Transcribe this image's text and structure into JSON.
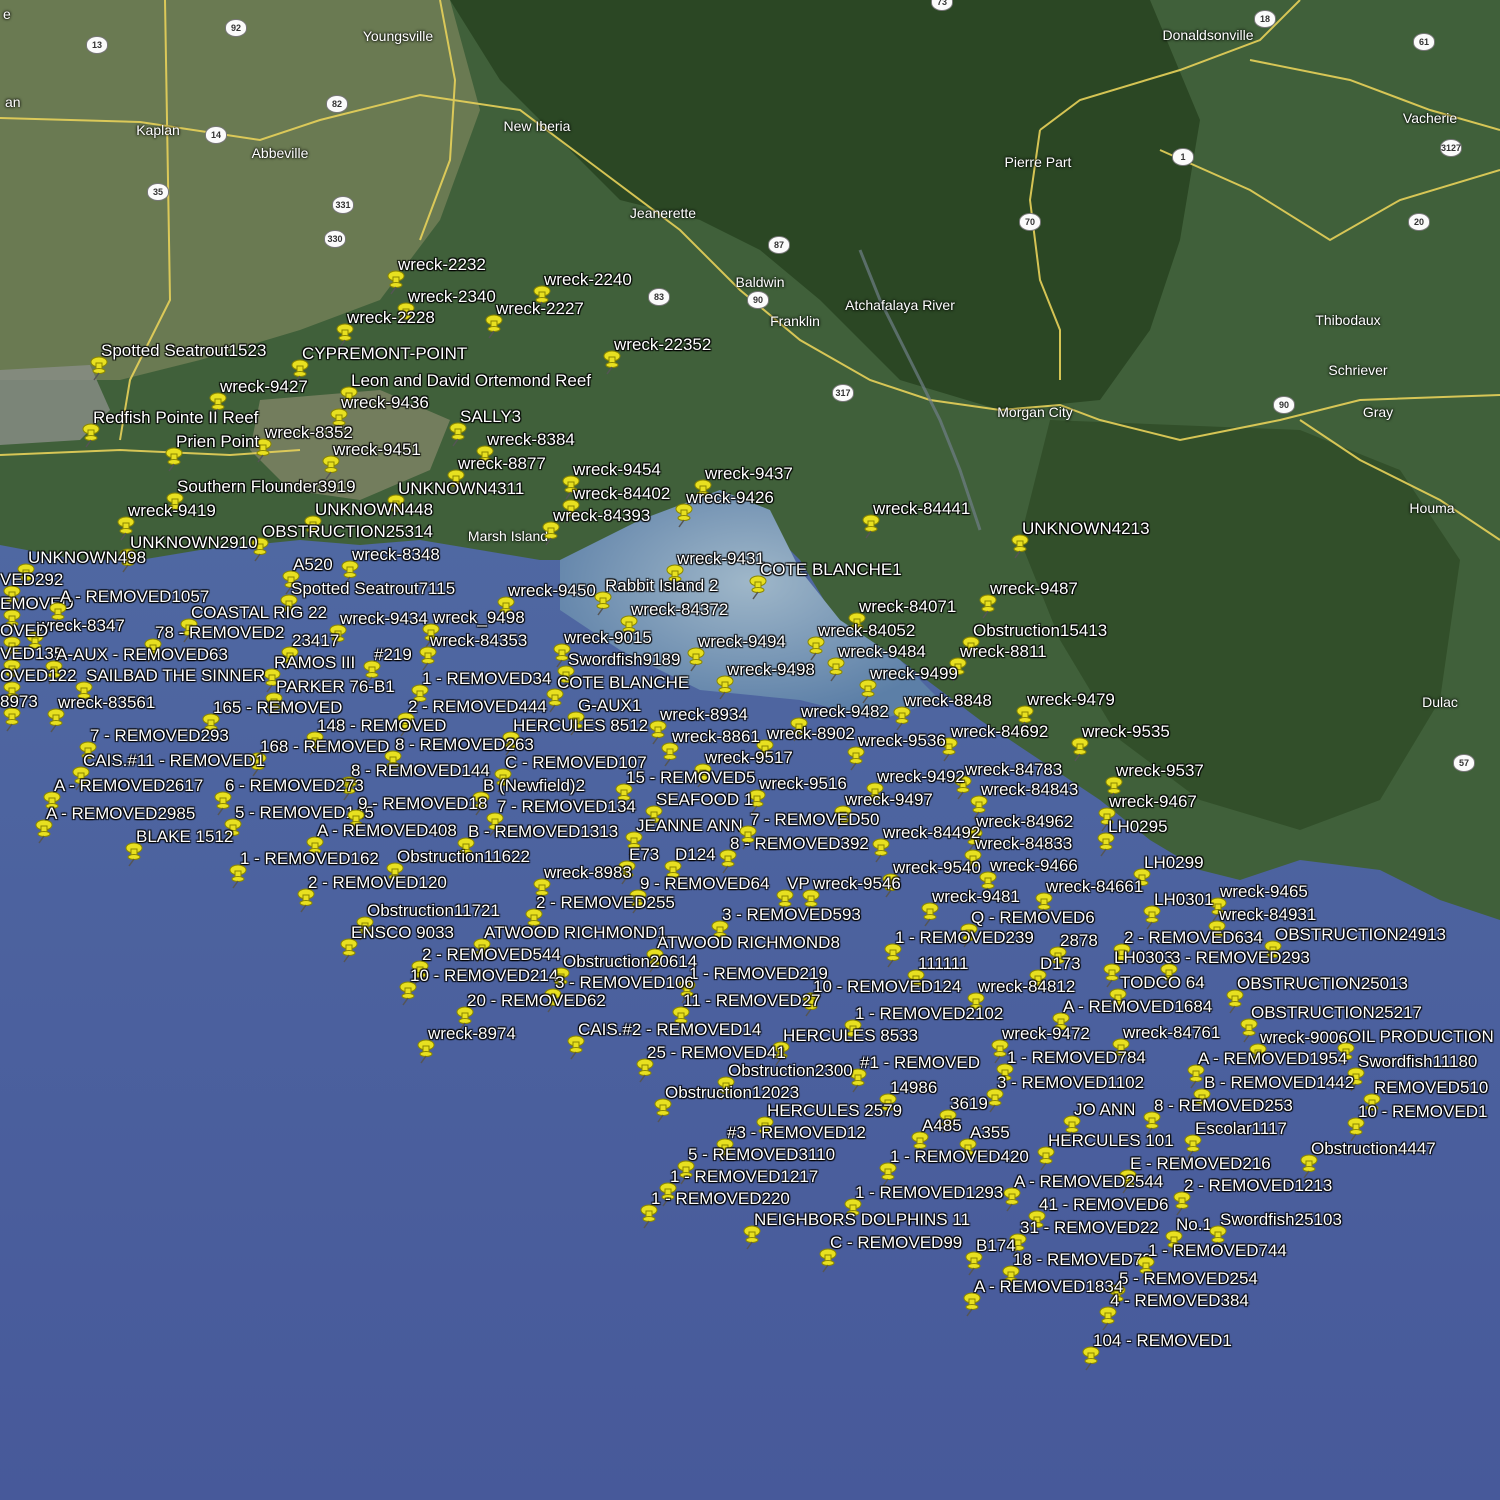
{
  "places": [
    {
      "name": "Youngsville"
    },
    {
      "name": "Kaplan"
    },
    {
      "name": "Abbeville"
    },
    {
      "name": "New Iberia"
    },
    {
      "name": "Jeanerette"
    },
    {
      "name": "Baldwin"
    },
    {
      "name": "Franklin"
    },
    {
      "name": "Atchafalaya River"
    },
    {
      "name": "Donaldsonville"
    },
    {
      "name": "Vacherie"
    },
    {
      "name": "Pierre Part"
    },
    {
      "name": "Morgan City"
    },
    {
      "name": "Thibodaux"
    },
    {
      "name": "Schriever"
    },
    {
      "name": "Gray"
    },
    {
      "name": "Houma"
    },
    {
      "name": "Dulac"
    },
    {
      "name": "Marsh Island"
    },
    {
      "name": "an"
    },
    {
      "name": "e"
    }
  ],
  "shields": [
    "92",
    "13",
    "82",
    "14",
    "35",
    "331",
    "330",
    "83",
    "90",
    "317",
    "87",
    "70",
    "1",
    "20",
    "3127",
    "61",
    "18",
    "90",
    "57",
    "73"
  ],
  "markers": [
    "wreck-2232",
    "wreck-2240",
    "wreck-2340",
    "wreck-2227",
    "wreck-2228",
    "wreck-22352",
    "Spotted Seatrout1523",
    "CYPREMONT-POINT",
    "Leon and David Ortemond Reef",
    "wreck-9427",
    "wreck-9436",
    "SALLY3",
    "Redfish Pointe II Reef",
    "wreck-8352",
    "wreck-8384",
    "Prien Point",
    "wreck-9451",
    "wreck-8877",
    "wreck-9454",
    "wreck-9437",
    "Southern Flounder3919",
    "UNKNOWN4311",
    "wreck-84402",
    "wreck-9426",
    "wreck-9419",
    "UNKNOWN448",
    "wreck-84393",
    "wreck-84441",
    "OBSTRUCTION25314",
    "UNKNOWN4213",
    "UNKNOWN2910",
    "UNKNOWN498",
    "wreck-8348",
    "wreck-9431",
    "COTE BLANCHE1",
    "A520",
    "VED292",
    "Spotted Seatrout7115",
    "wreck-9450",
    "Rabbit Island 2",
    "wreck-9487",
    "EMOVED",
    "A - REMOVED1057",
    "wreck-84372",
    "wreck-84071",
    "COASTAL RIG 22",
    "wreck-9434",
    "wreck_9498",
    "wreck-8347",
    "78 - REMOVED2",
    "23417",
    "wreck-84353",
    "wreck-9015",
    "wreck-9494",
    "wreck-84052",
    "Obstruction15413",
    "OVED",
    "VED135",
    "A-AUX - REMOVED63",
    "#219",
    "Swordfish9189",
    "wreck-9484",
    "wreck-8811",
    "RAMOS III",
    "OVED122",
    "SAILBAD THE SINNER",
    "wreck-9498",
    "1 - REMOVED34",
    "COTE BLANCHE",
    "wreck-9499",
    "PARKER 76-B1",
    "8973",
    "wreck-83561",
    "165 - REMOVED",
    "2 - REMOVED444",
    "G-AUX1",
    "wreck-8848",
    "wreck-9479",
    "wreck-8934",
    "wreck-9482",
    "148 - REMOVED",
    "HERCULES 8512",
    "wreck-8902",
    "wreck-8861",
    "wreck-84692",
    "wreck-9536",
    "wreck-9535",
    "7 - REMOVED293",
    "168 - REMOVED",
    "8 - REMOVED263",
    "wreck-9517",
    "CAIS.#11 - REMOVED1",
    "C - REMOVED107",
    "8 - REMOVED144",
    "wreck-84783",
    "wreck-9537",
    "A - REMOVED2617",
    "6 - REMOVED273",
    "B (Newfield)2",
    "15 - REMOVED5",
    "wreck-9516",
    "wreck-9492",
    "wreck-84843",
    "A - REMOVED2985",
    "5 - REMOVED145",
    "9 - REMOVED18",
    "7 - REMOVED134",
    "SEAFOOD 1",
    "wreck-9497",
    "wreck-9467",
    "A - REMOVED408",
    "B - REMOVED1313",
    "JEANNE ANN",
    "7 - REMOVED50",
    "wreck-84962",
    "LH0295",
    "BLAKE 1512",
    "wreck-84492",
    "8 - REMOVED392",
    "wreck-84833",
    "1 - REMOVED162",
    "Obstruction11622",
    "E73",
    "D124",
    "wreck-9540",
    "wreck-9466",
    "LH0299",
    "wreck-8983",
    "2 - REMOVED120",
    "9 - REMOVED64",
    "VP",
    "wreck-9546",
    "wreck-84661",
    "wreck-9465",
    "wreck-9481",
    "LH0301",
    "2 - REMOVED255",
    "Obstruction11721",
    "3 - REMOVED593",
    "Q - REMOVED6",
    "wreck-84931",
    "ENSCO 9033",
    "ATWOOD RICHMOND1",
    "1 - REMOVED239",
    "2878",
    "2 - REMOVED634",
    "OBSTRUCTION24913",
    "ATWOOD RICHMOND8",
    "2 - REMOVED544",
    "Obstruction20614",
    "111111",
    "D173",
    "LH0303",
    "3 - REMOVED293",
    "10 - REMOVED214",
    "1 - REMOVED219",
    "3 - REMOVED106",
    "TODCO 64",
    "OBSTRUCTION25013",
    "10 - REMOVED124",
    "wreck-84812",
    "20 - REMOVED62",
    "11 - REMOVED27",
    "A - REMOVED1684",
    "1 - REMOVED2102",
    "OBSTRUCTION25217",
    "wreck-8974",
    "CAIS.#2 - REMOVED14",
    "wreck-9472",
    "wreck-84761",
    "wreck-9006",
    "OIL PRODUCTION",
    "HERCULES 8533",
    "25 - REMOVED41",
    "1 - REMOVED784",
    "A - REMOVED1954",
    "Swordfish11180",
    "#1 - REMOVED",
    "Obstruction2300",
    "3 - REMOVED1102",
    "B - REMOVED1442",
    "REMOVED510",
    "14986",
    "Obstruction12023",
    "HERCULES 2579",
    "3619",
    "JO ANN",
    "8 - REMOVED253",
    "10 - REMOVED1",
    "A485",
    "A355",
    "#3 - REMOVED12",
    "Escolar1117",
    "HERCULES 101",
    "Obstruction4447",
    "5 - REMOVED3110",
    "1 - REMOVED420",
    "E - REMOVED216",
    "1 - REMOVED1217",
    "A - REMOVED2544",
    "2 - REMOVED1213",
    "1 - REMOVED220",
    "1 - REMOVED1293",
    "41 - REMOVED6",
    "NEIGHBORS DOLPHINS 11",
    "31 - REMOVED22",
    "No.1",
    "Swordfish25103",
    "C - REMOVED99",
    "B174",
    "18 - REMOVED73",
    "1 - REMOVED744",
    "5 - REMOVED254",
    "A - REMOVED1834",
    "4 - REMOVED384",
    "104 - REMOVED1"
  ],
  "colors": {
    "ocean": "#4a5d96",
    "bay": "#6f8fa8",
    "land": "#3d5c32",
    "forest": "#2e4a26",
    "road": "#e8d25a",
    "pin": "#e8e020",
    "text": "#ffffff"
  }
}
